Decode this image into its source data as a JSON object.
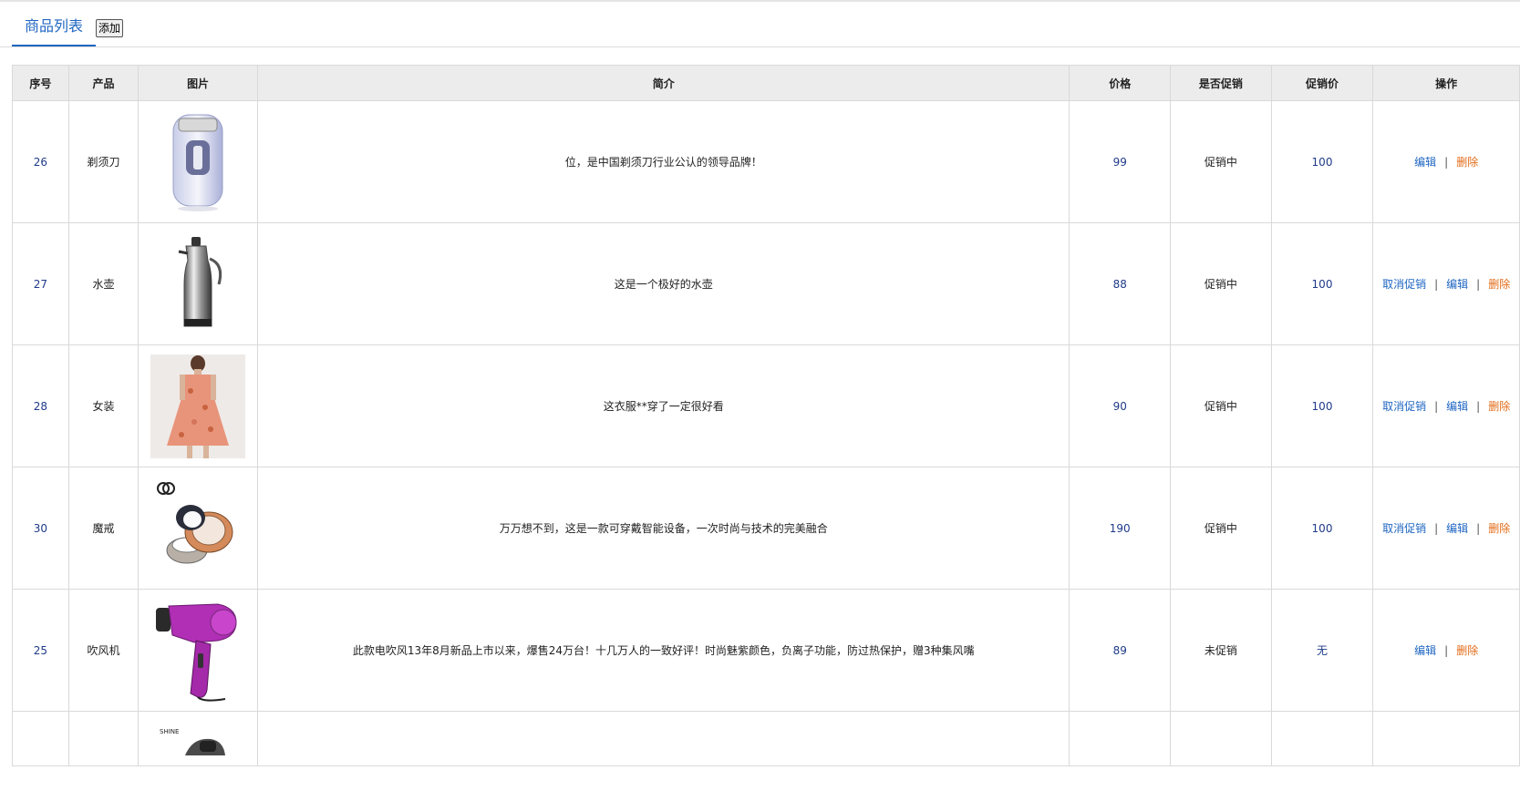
{
  "tabs": {
    "title": "商品列表",
    "add_label": "添加"
  },
  "table": {
    "headers": [
      "序号",
      "产品",
      "图片",
      "简介",
      "价格",
      "是否促销",
      "促销价",
      "操作"
    ],
    "rows": [
      {
        "id": "26",
        "name": "剃须刀",
        "image": "shaver-image",
        "desc": "位，是中国剃须刀行业公认的领导品牌！",
        "price": "99",
        "status": "促销中",
        "promo_price": "100",
        "ops": [
          "编辑",
          "删除"
        ]
      },
      {
        "id": "27",
        "name": "水壶",
        "image": "kettle-image",
        "desc": "这是一个极好的水壶",
        "price": "88",
        "status": "促销中",
        "promo_price": "100",
        "ops": [
          "取消促销",
          "编辑",
          "删除"
        ]
      },
      {
        "id": "28",
        "name": "女装",
        "image": "dress-image",
        "desc": "这衣服**穿了一定很好看",
        "price": "90",
        "status": "促销中",
        "promo_price": "100",
        "ops": [
          "取消促销",
          "编辑",
          "删除"
        ]
      },
      {
        "id": "30",
        "name": "魔戒",
        "image": "smart-ring-image",
        "desc": "万万想不到，这是一款可穿戴智能设备，一次时尚与技术的完美融合",
        "price": "190",
        "status": "促销中",
        "promo_price": "100",
        "ops": [
          "取消促销",
          "编辑",
          "删除"
        ]
      },
      {
        "id": "25",
        "name": "吹风机",
        "image": "hair-dryer-image",
        "desc": "此款电吹风13年8月新品上市以来，爆售24万台！十几万人的一致好评！时尚魅紫颜色，负离子功能，防过热保护，赠3种集风嘴",
        "price": "89",
        "status": "未促销",
        "promo_price": "无",
        "ops": [
          "编辑",
          "删除"
        ]
      }
    ],
    "partial_row": {
      "image": "watch-image",
      "brand_text": "SHINE"
    },
    "separator": "|"
  },
  "colors": {
    "accent": "#1f66c2",
    "delete": "#e36b17",
    "header_bg": "#ececec"
  }
}
